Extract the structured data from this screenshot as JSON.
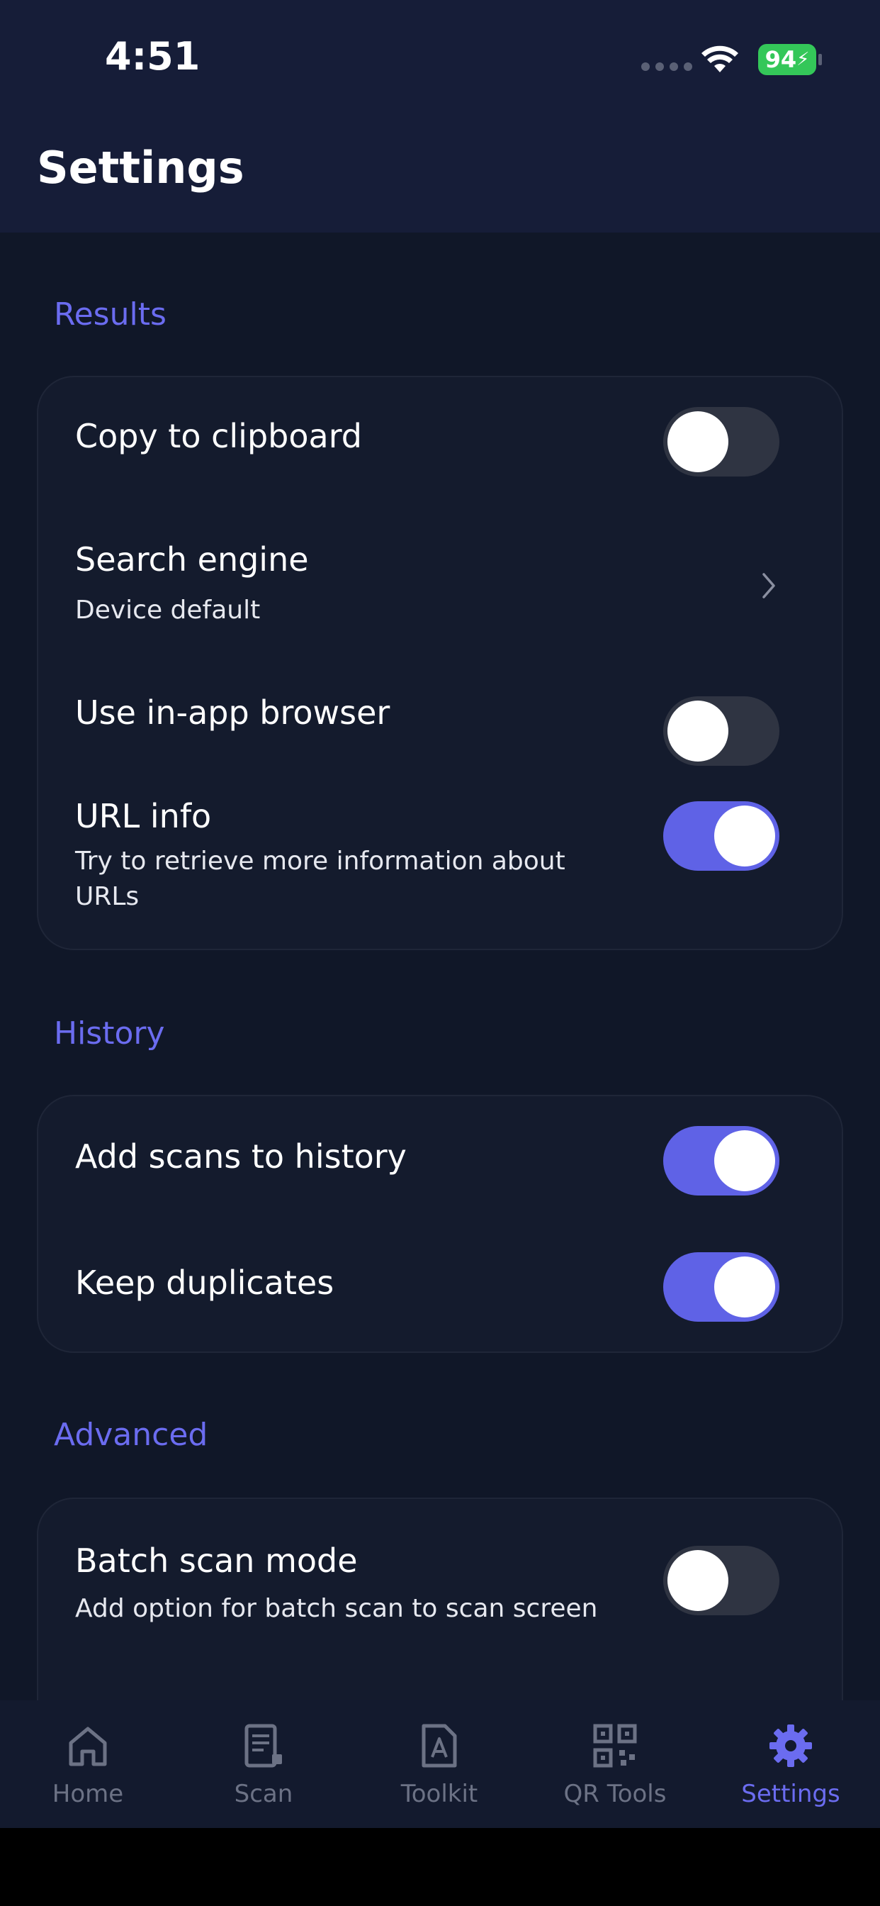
{
  "status": {
    "time": "4:51",
    "battery": "94"
  },
  "header": {
    "title": "Settings"
  },
  "sections": {
    "results": {
      "title": "Results",
      "copy_to_clipboard": {
        "label": "Copy to clipboard",
        "enabled": false
      },
      "search_engine": {
        "label": "Search engine",
        "value": "Device default"
      },
      "in_app_browser": {
        "label": "Use in-app browser",
        "enabled": false
      },
      "url_info": {
        "label": "URL info",
        "description_line1": "Try to retrieve more information about",
        "description_line2": "URLs",
        "enabled": true
      }
    },
    "history": {
      "title": "History",
      "add_scans": {
        "label": "Add scans to history",
        "enabled": true
      },
      "keep_duplicates": {
        "label": "Keep duplicates",
        "enabled": true
      }
    },
    "advanced": {
      "title": "Advanced",
      "batch_scan": {
        "label": "Batch scan mode",
        "description": "Add option for batch scan to scan screen",
        "enabled": false
      }
    }
  },
  "tabs": [
    {
      "label": "Home",
      "icon": "home-icon"
    },
    {
      "label": "Scan",
      "icon": "scan-icon"
    },
    {
      "label": "Toolkit",
      "icon": "toolkit-icon"
    },
    {
      "label": "QR Tools",
      "icon": "qr-icon"
    },
    {
      "label": "Settings",
      "icon": "gear-icon",
      "active": true
    }
  ],
  "colors": {
    "accent": "#6b6cf0",
    "toggle_on": "#5f62e6",
    "background": "#101728",
    "header": "#161d38"
  }
}
